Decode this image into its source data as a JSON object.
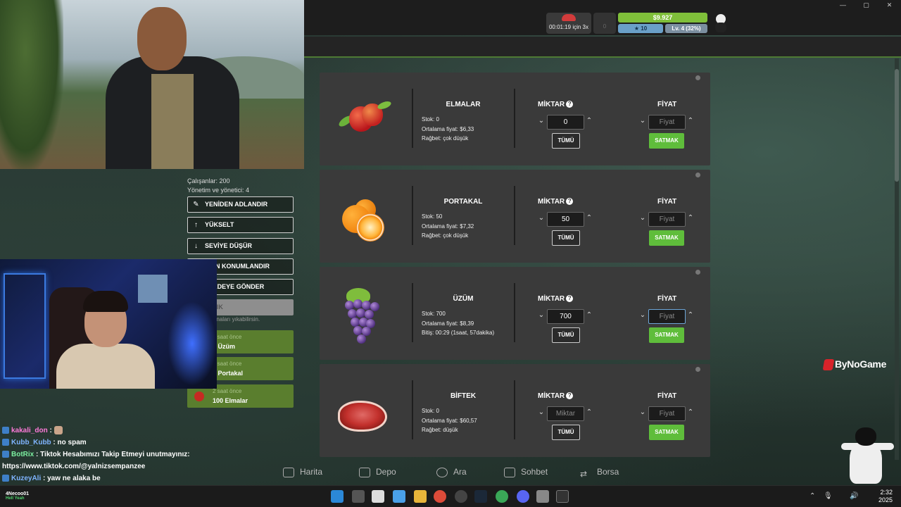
{
  "window": {
    "minimize": "—",
    "maximize": "▢",
    "close": "✕"
  },
  "hud": {
    "timer": "00:01:19 için 3x",
    "slot_value": "0",
    "money": "$9.927",
    "stars": "10",
    "level": "Lv. 4 (32%)"
  },
  "building": {
    "lines": [
      "Çalışanlar: 200",
      "Yönetim ve yönetici: 4"
    ],
    "buttons": [
      {
        "label": "YENİDEN ADLANDIR",
        "icon": "edit-icon"
      },
      {
        "label": "YÜKSELT",
        "icon": "arrow-up-icon"
      },
      {
        "label": "SEVİYE DÜŞÜR",
        "icon": "arrow-down-icon"
      },
      {
        "label": "IDEN KONUMLANDIR",
        "icon": "relocate-icon"
      },
      {
        "label": "AYEDEYE GÖNDER",
        "icon": "send-icon"
      },
      {
        "label": "YI YIK",
        "icon": "demolish-icon"
      }
    ],
    "note": "n itibaren binaları yıkabilirsin.",
    "activity": [
      {
        "time": "2 saat önce",
        "text": "5 Üzüm"
      },
      {
        "time": "2 saat önce",
        "text": "0 Portakal"
      },
      {
        "time": "2 saat önce",
        "text": "100 Elmalar"
      }
    ]
  },
  "chat": [
    {
      "user": "kakali_don",
      "text": "",
      "color": "pink"
    },
    {
      "user": "Kubb_Kubb",
      "text": "no spam",
      "color": "blue"
    },
    {
      "user": "BotRix",
      "text": "Tiktok Hesabımızı Takip Etmeyi unutmayınız:",
      "color": "green"
    },
    {
      "user": "",
      "text": "https://www.tiktok.com/@yalnizsempanzee",
      "color": ""
    },
    {
      "user": "KuzeyAli",
      "text": "yaw ne alaka be",
      "color": "blue"
    }
  ],
  "market": {
    "qty_label": "MİKTAR",
    "price_label": "FİYAT",
    "all_label": "TÜMÜ",
    "sell_label": "SATMAK",
    "price_placeholder": "Fiyat",
    "qty_placeholder": "Miktar",
    "items": [
      {
        "name": "ELMALAR",
        "info": [
          "Stok: 0",
          "Ortalama fiyat: $6,33",
          "Rağbet: çok düşük"
        ],
        "qty": "0"
      },
      {
        "name": "PORTAKAL",
        "info": [
          "Stok: 50",
          "Ortalama fiyat: $7,32",
          "Rağbet: çok düşük"
        ],
        "qty": "50"
      },
      {
        "name": "ÜZÜM",
        "info": [
          "Stok: 700",
          "Ortalama fiyat: $8,39",
          "Bitiş: 00:29 (1saat, 57dakika)"
        ],
        "qty": "700"
      },
      {
        "name": "BİFTEK",
        "info": [
          "Stok: 0",
          "Ortalama fiyat: $60,57",
          "Rağbet: düşük"
        ],
        "qty": ""
      }
    ]
  },
  "nav": [
    "Harita",
    "Depo",
    "Ara",
    "Sohbet",
    "Borsa"
  ],
  "watermark": "ByNoGame",
  "taskbar": {
    "user": "4Necoo01",
    "user_sub": "Hell Yeah",
    "time": "2:32",
    "date": "2025"
  },
  "colors": {
    "accent_green": "#5fbd3b",
    "money_bar": "#7fbf3a",
    "card_bg": "#3a3a3a"
  }
}
